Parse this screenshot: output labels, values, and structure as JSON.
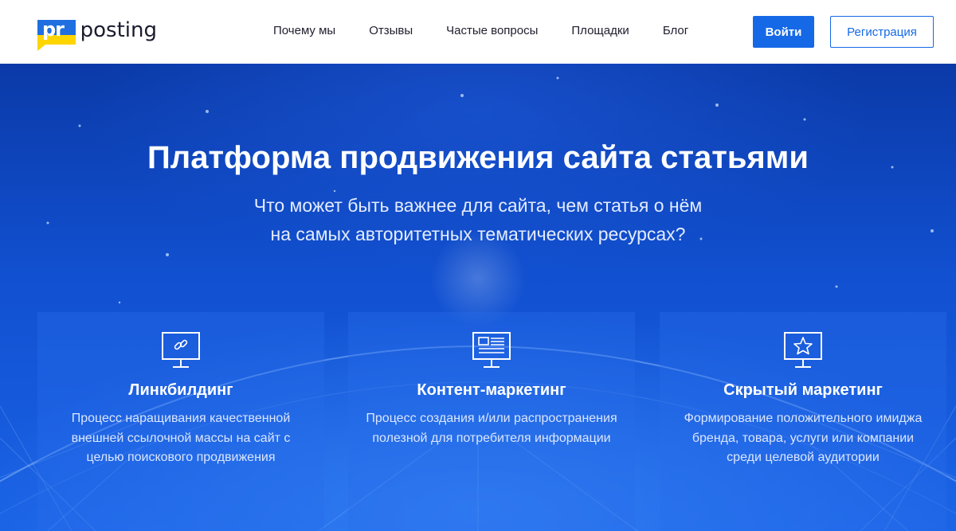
{
  "brand": {
    "logo_mark": "pr",
    "logo_text": "posting",
    "colors": {
      "flag_blue": "#1f6fe0",
      "flag_yellow": "#ffd500",
      "accent": "#1669e6"
    }
  },
  "nav": {
    "items": [
      {
        "label": "Почему мы"
      },
      {
        "label": "Отзывы"
      },
      {
        "label": "Частые вопросы"
      },
      {
        "label": "Площадки"
      },
      {
        "label": "Блог"
      }
    ],
    "login_label": "Войти",
    "register_label": "Регистрация"
  },
  "hero": {
    "title": "Платформа продвижения сайта статьями",
    "subtitle_line1": "Что может быть важнее для сайта, чем статья о нём",
    "subtitle_line2": "на самых авторитетных тематических ресурсах?"
  },
  "cards": [
    {
      "icon": "monitor-link-icon",
      "title": "Линкбилдинг",
      "text": "Процесс наращивания качественной внешней ссылочной массы на сайт с целью поискового продвижения"
    },
    {
      "icon": "monitor-article-icon",
      "title": "Контент-маркетинг",
      "text": "Процесс создания и/или распространения полезной для потребителя информации"
    },
    {
      "icon": "monitor-star-icon",
      "title": "Скрытый маркетинг",
      "text": "Формирование положительного имиджа бренда, товара, услуги или компании среди целевой аудитории"
    }
  ]
}
